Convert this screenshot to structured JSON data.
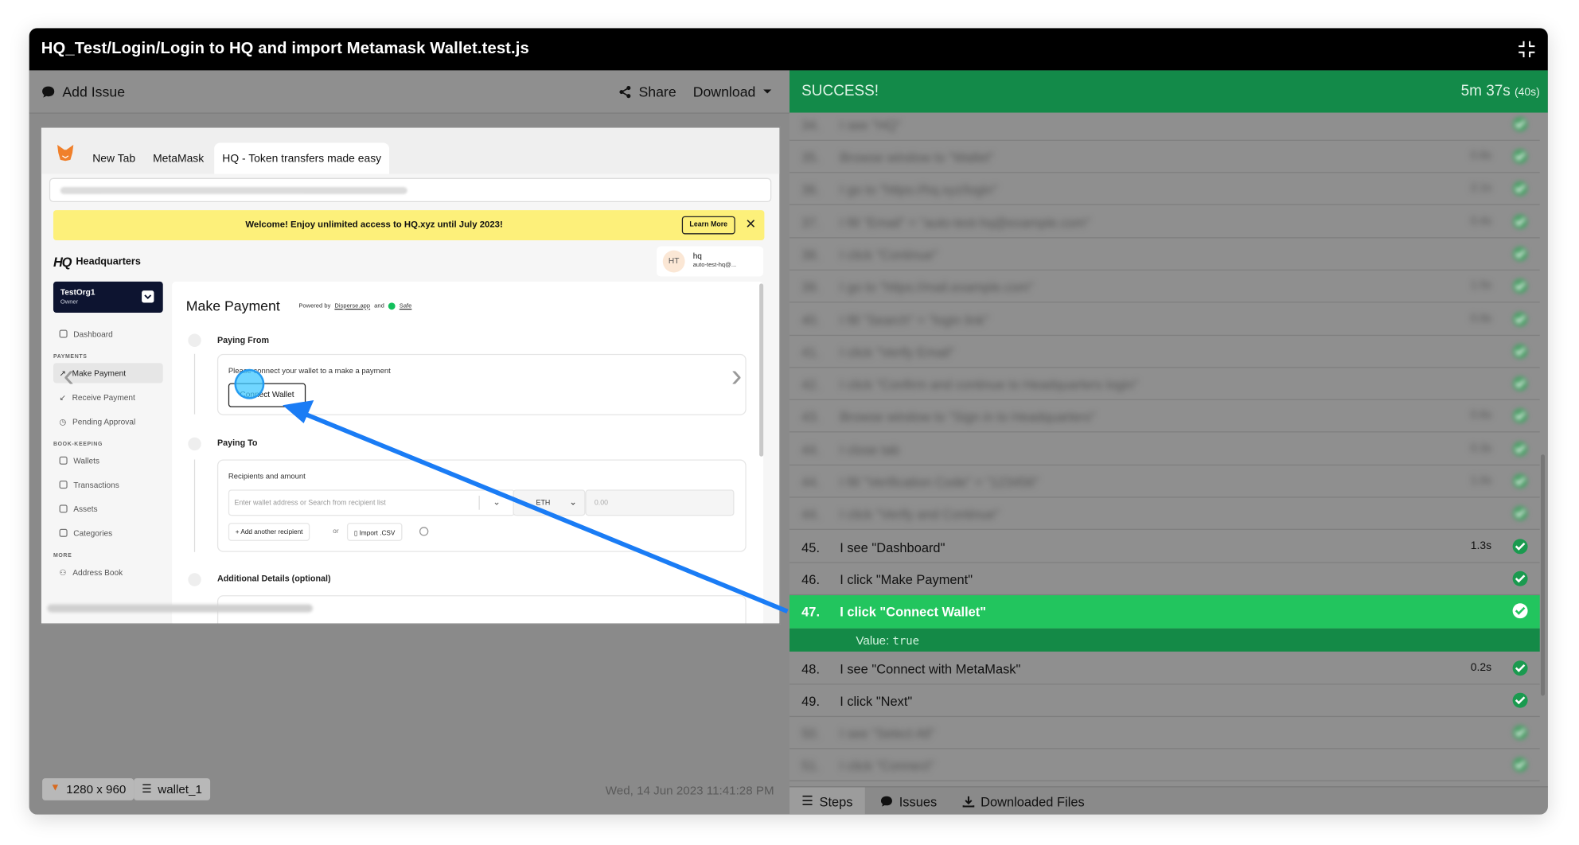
{
  "window": {
    "title": "HQ_Test/Login/Login to HQ and import Metamask Wallet.test.js"
  },
  "toolbar": {
    "add_issue": "Add Issue",
    "share": "Share",
    "download": "Download"
  },
  "browser": {
    "tabs": [
      "New Tab",
      "MetaMask",
      "HQ - Token transfers made easy"
    ],
    "banner_text": "Welcome! Enjoy unlimited access to HQ.xyz until July 2023!",
    "banner_button": "Learn More"
  },
  "app": {
    "brand_mark": "HQ",
    "brand_name": "Headquarters",
    "user": {
      "initials": "HT",
      "name": "hq",
      "email": "auto-test-hq@..."
    },
    "org": {
      "name": "TestOrg1",
      "role": "Owner"
    },
    "sidebar": {
      "dashboard": "Dashboard",
      "payments_header": "PAYMENTS",
      "make_payment": "Make Payment",
      "receive_payment": "Receive Payment",
      "pending_approval": "Pending Approval",
      "bookkeeping_header": "BOOK-KEEPING",
      "wallets": "Wallets",
      "transactions": "Transactions",
      "assets": "Assets",
      "categories": "Categories",
      "more_header": "MORE",
      "address_book": "Address Book"
    },
    "main": {
      "title": "Make Payment",
      "powered_by": "Powered by",
      "disperse": "Disperse.app",
      "and": "and",
      "safe": "Safe",
      "paying_from": "Paying From",
      "connect_prompt": "Please connect your wallet to a make a payment",
      "connect_button": "Connect Wallet",
      "paying_to": "Paying To",
      "recipients_label": "Recipients and amount",
      "recipient_placeholder": "Enter wallet address or Search from recipient list",
      "token": "ETH",
      "amount_placeholder": "0.00",
      "add_recipient": "+ Add another recipient",
      "or": "or",
      "import_csv": "Import .CSV",
      "additional_details": "Additional Details (optional)"
    }
  },
  "footer": {
    "resolution": "1280 x 960",
    "wallet": "wallet_1",
    "timestamp": "Wed, 14 Jun 2023 11:41:28 PM"
  },
  "status": {
    "label": "SUCCESS!",
    "duration": "5m 37s",
    "duration_sub": "(40s)"
  },
  "steps": [
    {
      "num": "45.",
      "text": "I see \"Dashboard\"",
      "time": "1.3s"
    },
    {
      "num": "46.",
      "text": "I click \"Make Payment\"",
      "time": ""
    },
    {
      "num": "47.",
      "text": "I click \"Connect Wallet\"",
      "time": ""
    },
    {
      "num": "48.",
      "text": "I see \"Connect with MetaMask\"",
      "time": "0.2s"
    },
    {
      "num": "49.",
      "text": "I click \"Next\"",
      "time": ""
    }
  ],
  "current_step_value": {
    "label": "Value:",
    "value": "true"
  },
  "bottom_tabs": {
    "steps": "Steps",
    "issues": "Issues",
    "downloaded_files": "Downloaded Files"
  },
  "colors": {
    "success": "#138a49",
    "current_step": "#22c55e",
    "arrow": "#1a7cf5"
  }
}
